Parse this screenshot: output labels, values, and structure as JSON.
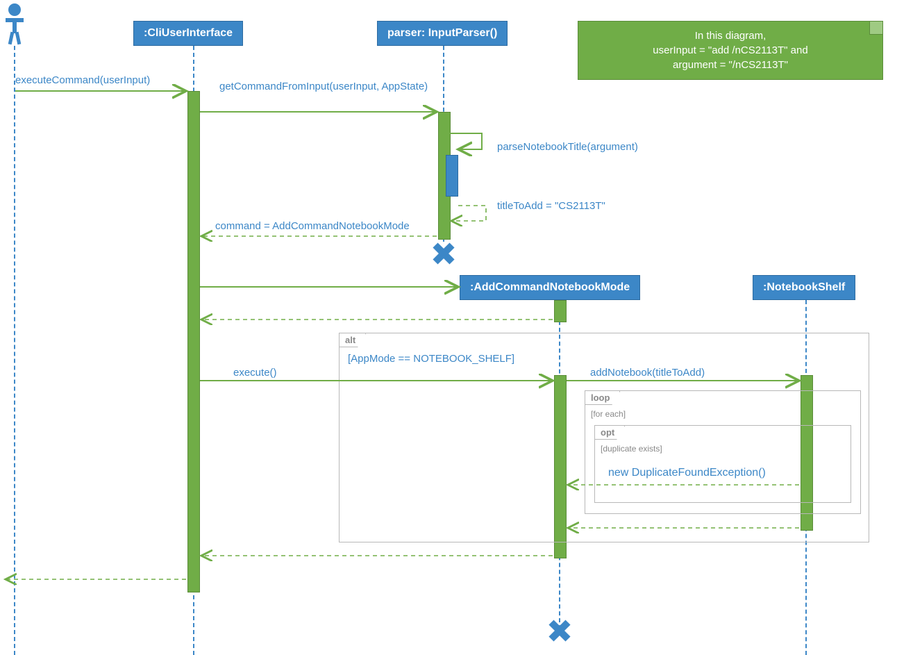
{
  "participants": {
    "cli": {
      "label": ":CliUserInterface"
    },
    "parser": {
      "label": "parser: InputParser()"
    },
    "acnm": {
      "label": ":AddCommandNotebookMode"
    },
    "shelf": {
      "label": ":NotebookShelf"
    }
  },
  "note": {
    "line1": "In this diagram,",
    "line2": "userInput = \"add /nCS2113T\" and",
    "line3": "argument = \"/nCS2113T\""
  },
  "messages": {
    "executeCommand": "executeCommand(userInput)",
    "getCommandFromInput": "getCommandFromInput(userInput, AppState)",
    "parseNotebookTitle": "parseNotebookTitle(argument)",
    "titleToAdd": "titleToAdd = \"CS2113T\"",
    "commandReturn": "command = AddCommandNotebookMode",
    "execute": "execute()",
    "addNotebook": "addNotebook(titleToAdd)",
    "newDuplicate": "new DuplicateFoundException()"
  },
  "fragments": {
    "alt": {
      "tag": "alt",
      "guard": "[AppMode == NOTEBOOK_SHELF]"
    },
    "loop": {
      "tag": "loop",
      "guard": "[for each]"
    },
    "opt": {
      "tag": "opt",
      "guard": "[duplicate exists]"
    }
  },
  "colors": {
    "blue": "#3c87c7",
    "green": "#70ad47"
  }
}
